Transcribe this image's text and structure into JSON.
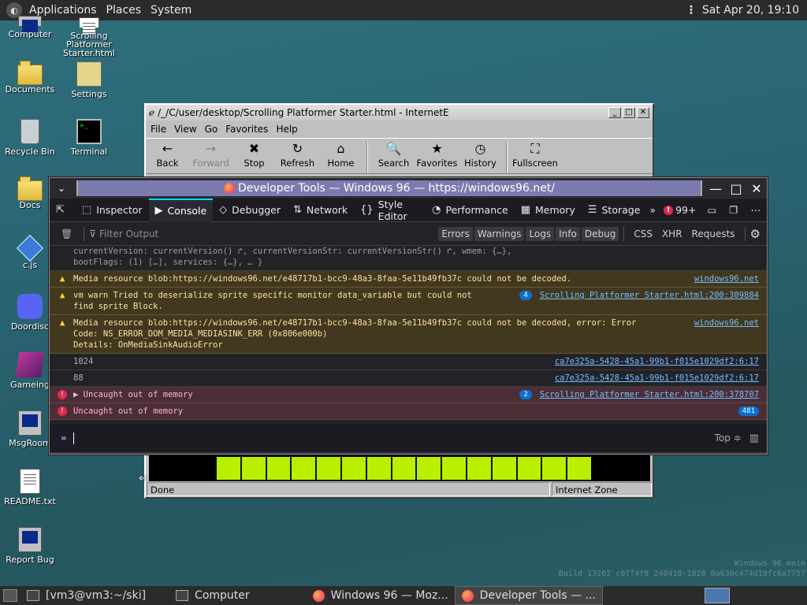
{
  "top_panel": {
    "menus": [
      "Applications",
      "Places",
      "System"
    ],
    "clock": "Sat Apr 20, 19:10"
  },
  "desktop_icons": [
    {
      "label": "Computer",
      "icon": "computer-icon"
    },
    {
      "label": "Scrolling Platformer Starter.html",
      "icon": "html-file-icon"
    },
    {
      "label": "Documents",
      "icon": "folder-icon"
    },
    {
      "label": "Settings",
      "icon": "settings-icon"
    },
    {
      "label": "Recycle Bin",
      "icon": "recycle-bin-icon"
    },
    {
      "label": "Terminal",
      "icon": "terminal-icon"
    },
    {
      "label": "Docs",
      "icon": "folder-icon"
    },
    {
      "label": "c.js",
      "icon": "js-file-icon"
    },
    {
      "label": "Doordisc",
      "icon": "discord-icon"
    },
    {
      "label": "Gameing",
      "icon": "cube-icon"
    },
    {
      "label": "MsgRoom",
      "icon": "msgroom-icon"
    },
    {
      "label": "README.txt",
      "icon": "text-file-icon"
    },
    {
      "label": "Report Bug",
      "icon": "report-bug-icon"
    }
  ],
  "ie_window": {
    "title": "/_/C/user/desktop/Scrolling Platformer Starter.html - InternetE",
    "menu": [
      "File",
      "View",
      "Go",
      "Favorites",
      "Help"
    ],
    "toolbar": [
      {
        "label": "Back",
        "icon": "←"
      },
      {
        "label": "Forward",
        "icon": "→"
      },
      {
        "label": "Stop",
        "icon": "✖"
      },
      {
        "label": "Refresh",
        "icon": "↻"
      },
      {
        "label": "Home",
        "icon": "⌂"
      },
      {
        "label": "Search",
        "icon": "🔍"
      },
      {
        "label": "Favorites",
        "icon": "★"
      },
      {
        "label": "History",
        "icon": "◷"
      },
      {
        "label": "Fullscreen",
        "icon": "⛶"
      }
    ],
    "status": "Done",
    "zone": "Internet Zone"
  },
  "devtools": {
    "title": "Developer Tools — Windows 96 — https://windows96.net/",
    "tabs": [
      {
        "label": "Inspector",
        "icon": "⬚"
      },
      {
        "label": "Console",
        "icon": "▶"
      },
      {
        "label": "Debugger",
        "icon": "◇"
      },
      {
        "label": "Network",
        "icon": "⇅"
      },
      {
        "label": "Style Editor",
        "icon": "{}"
      },
      {
        "label": "Performance",
        "icon": "◔"
      },
      {
        "label": "Memory",
        "icon": "▦"
      },
      {
        "label": "Storage",
        "icon": "☰"
      }
    ],
    "error_count": "99+",
    "filter_placeholder": "Filter Output",
    "filters": [
      "Errors",
      "Warnings",
      "Logs",
      "Info",
      "Debug"
    ],
    "filter_links": [
      "CSS",
      "XHR",
      "Requests"
    ],
    "messages": [
      {
        "type": "partial",
        "text": "currentVersion: currentVersion() ↱, currentVersionStr: currentVersionStr() ↱, wmem: {…},\nbootFlags: (1) […], services: {…}, … }",
        "source": "",
        "badge": ""
      },
      {
        "type": "warn",
        "text": "Media resource blob:https://windows96.net/e48717b1-bcc9-48a3-8faa-5e11b49fb37c could not be decoded.",
        "source": "windows96.net",
        "badge": ""
      },
      {
        "type": "warn",
        "text": "vm warn Tried to deserialize sprite specific monitor data_variable but could not\nfind sprite Block.",
        "source": "Scrolling Platformer Starter.html:200:309884",
        "badge": "4"
      },
      {
        "type": "warn",
        "text": "Media resource blob:https://windows96.net/e48717b1-bcc9-48a3-8faa-5e11b49fb37c could not be decoded, error: Error\nCode: NS_ERROR_DOM_MEDIA_MEDIASINK_ERR (0x806e000b)\nDetails: OnMediaSinkAudioError",
        "source": "windows96.net",
        "badge": ""
      },
      {
        "type": "log",
        "text": "1024",
        "source": "ca7e325a-5428-45a1-99b1-f015e1029df2:6:17",
        "badge": ""
      },
      {
        "type": "log",
        "text": "88",
        "source": "ca7e325a-5428-45a1-99b1-f015e1029df2:6:17",
        "badge": ""
      },
      {
        "type": "err",
        "text": "▶ Uncaught out of memory",
        "source": "Scrolling Platformer Starter.html:200:378707",
        "badge": "2"
      },
      {
        "type": "err",
        "text": "Uncaught out of memory",
        "source": "",
        "badge": "481"
      }
    ],
    "input_context": "Top ≑"
  },
  "taskbar": {
    "items": [
      {
        "label": "[vm3@vm3:~/ski]",
        "icon": "terminal-icon",
        "active": false
      },
      {
        "label": "Computer",
        "icon": "computer-icon",
        "active": false
      },
      {
        "label": "Windows 96 — Moz...",
        "icon": "firefox-icon",
        "active": false
      },
      {
        "label": "Developer Tools — ...",
        "icon": "firefox-icon",
        "active": true
      }
    ]
  },
  "watermark": {
    "line1": "Windows 96 main",
    "line2": "Build 13202 c0ff4f8 240418-1828 0a630c474d19fc6a7757"
  },
  "colors": {
    "accent": "#00ddff",
    "warn_bg": "#42381f",
    "error_bg": "#4b2f36",
    "link": "#75bfff",
    "game_block": "#b8f000"
  }
}
